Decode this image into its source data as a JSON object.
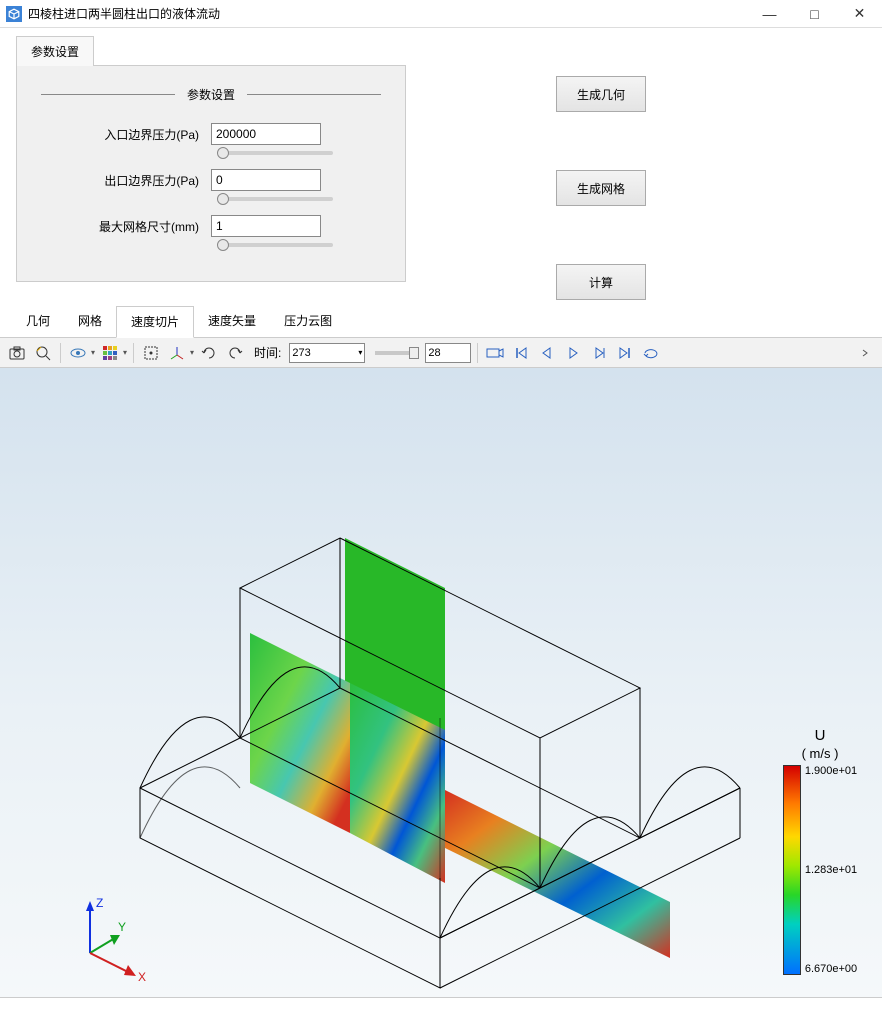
{
  "window": {
    "title": "四棱柱进口两半圆柱出口的液体流动",
    "min_icon": "—",
    "max_icon": "□",
    "close_icon": "✕"
  },
  "params_tab": {
    "label": "参数设置"
  },
  "params": {
    "header": "参数设置",
    "inlet": {
      "label": "入口边界压力(Pa)",
      "value": "200000"
    },
    "outlet": {
      "label": "出口边界压力(Pa)",
      "value": "0"
    },
    "mesh": {
      "label": "最大网格尺寸(mm)",
      "value": "1"
    }
  },
  "actions": {
    "geometry": "生成几何",
    "mesh": "生成网格",
    "compute": "计算"
  },
  "result_tabs": {
    "geometry": "几何",
    "mesh": "网格",
    "vel_slice": "速度切片",
    "vel_vector": "速度矢量",
    "pressure": "压力云图"
  },
  "toolbar": {
    "time_label": "时间:",
    "time_value": "273",
    "frame_value": "28"
  },
  "legend": {
    "title": "U",
    "unit": "( m/s )",
    "ticks": {
      "max": "1.900e+01",
      "mid": "1.283e+01",
      "low": "6.670e+00"
    }
  },
  "axes": {
    "x": "X",
    "y": "Y",
    "z": "Z"
  }
}
